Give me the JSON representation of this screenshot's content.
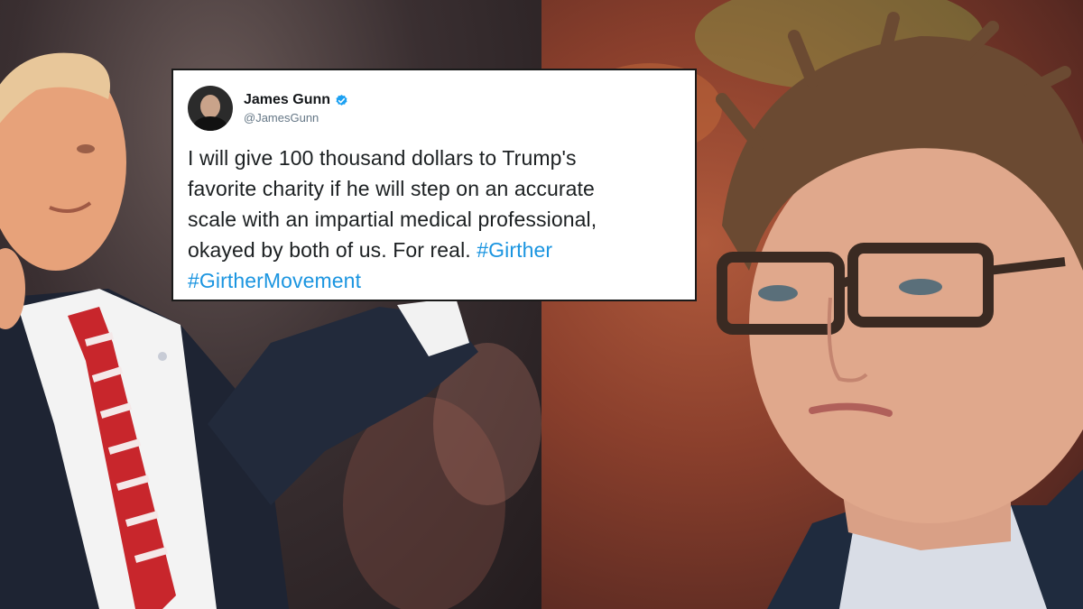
{
  "tweet": {
    "display_name": "James Gunn",
    "handle": "@JamesGunn",
    "verified_icon": "verified-badge-icon",
    "text_lines": [
      "I will give 100 thousand dollars to Trump's",
      "favorite charity if he will step on an accurate",
      "scale with an impartial medical professional,",
      "okayed by both of us. For real. "
    ],
    "hashtag_1": "#Girther",
    "hashtag_2": "#GirtherMovement"
  },
  "colors": {
    "hashtag": "#1b95e0",
    "verified": "#1da1f2",
    "card_background": "#ffffff"
  }
}
